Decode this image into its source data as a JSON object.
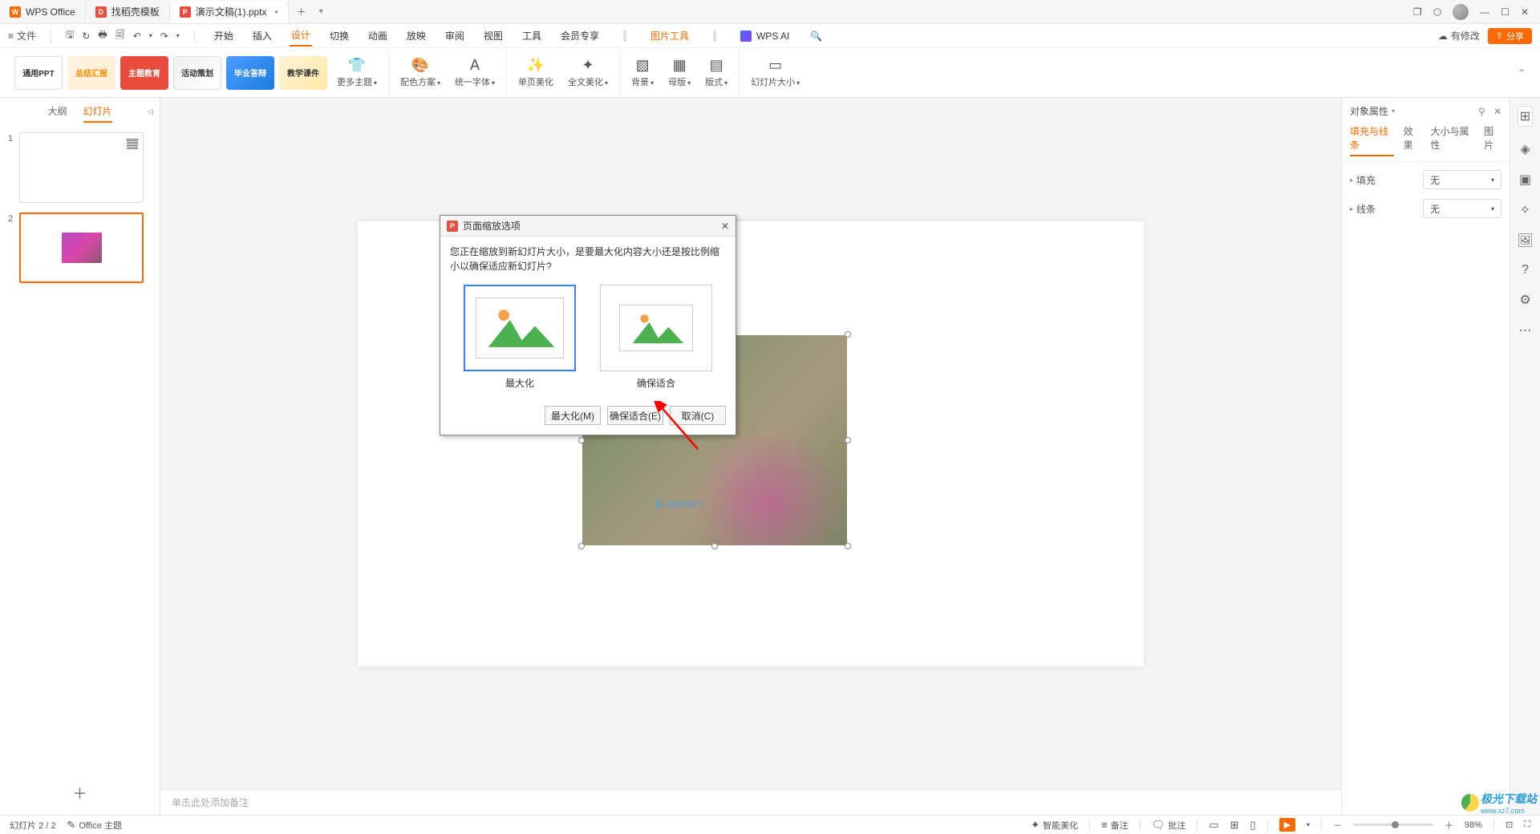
{
  "titlebar": {
    "tabs": [
      {
        "icon": "W",
        "label": "WPS Office"
      },
      {
        "icon": "D",
        "label": "找稻壳模板"
      },
      {
        "icon": "P",
        "label": "演示文稿(1).pptx",
        "dirty": true,
        "active": true
      }
    ]
  },
  "menubar": {
    "file": "文件",
    "tabs": [
      "开始",
      "插入",
      "设计",
      "切换",
      "动画",
      "放映",
      "审阅",
      "视图",
      "工具",
      "会员专享"
    ],
    "active_tab": "设计",
    "image_tools": "图片工具",
    "ai": "WPS AI",
    "cloud": "有修改",
    "share": "分享"
  },
  "ribbon": {
    "themes": [
      "通用PPT",
      "总结汇报",
      "主题教育",
      "活动策划",
      "毕业答辩",
      "教学课件"
    ],
    "items": [
      "更多主题",
      "配色方案",
      "统一字体",
      "单页美化",
      "全文美化",
      "背景",
      "母版",
      "版式",
      "幻灯片大小"
    ]
  },
  "left": {
    "tab_outline": "大纲",
    "tab_slides": "幻灯片",
    "slides": [
      {
        "num": "1"
      },
      {
        "num": "2",
        "selected": true
      }
    ]
  },
  "canvas": {
    "tips": "操作技巧",
    "notes_placeholder": "单击此处添加备注"
  },
  "right_panel": {
    "title": "对象属性",
    "tabs": [
      "填充与线条",
      "效果",
      "大小与属性",
      "图片"
    ],
    "active_tab": "填充与线条",
    "fill_label": "填充",
    "fill_value": "无",
    "line_label": "线条",
    "line_value": "无"
  },
  "dialog": {
    "title": "页面缩放选项",
    "message": "您正在缩放到新幻灯片大小，是要最大化内容大小还是按比例缩小以确保适应新幻灯片?",
    "opt_max": "最大化",
    "opt_fit": "确保适合",
    "btn_max": "最大化(M)",
    "btn_fit": "确保适合(E)",
    "btn_cancel": "取消(C)"
  },
  "statusbar": {
    "slide_pos": "幻灯片 2 / 2",
    "theme": "Office 主题",
    "smart_beautify": "智能美化",
    "notes": "备注",
    "comments": "批注",
    "zoom": "98%"
  },
  "watermark": {
    "name": "极光下载站",
    "url": "www.xz7.com"
  }
}
